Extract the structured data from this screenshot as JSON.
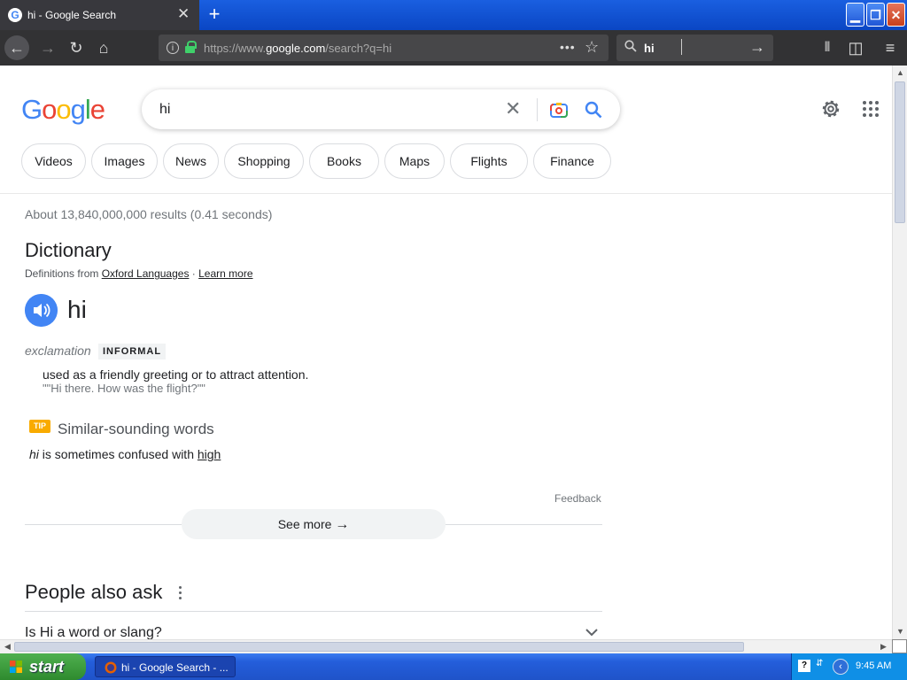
{
  "browser": {
    "tab_title": "hi - Google Search",
    "url_prefix": "https://www.",
    "url_domain": "google.com",
    "url_path": "/search?q=hi",
    "search_value": "hi"
  },
  "google": {
    "logo": [
      "G",
      "o",
      "o",
      "g",
      "l",
      "e"
    ],
    "logo_colors": [
      "#4285f4",
      "#ea4335",
      "#fbbc05",
      "#4285f4",
      "#34a853",
      "#ea4335"
    ],
    "query": "hi",
    "tabs": [
      "Videos",
      "Images",
      "News",
      "Shopping",
      "Books",
      "Maps",
      "Flights",
      "Finance"
    ],
    "stats": "About 13,840,000,000 results (0.41 seconds)"
  },
  "dictionary": {
    "title": "Dictionary",
    "source_prefix": "Definitions from ",
    "source_name": "Oxford Languages",
    "source_sep": " · ",
    "learn_more": "Learn more",
    "word": "hi",
    "part_of_speech": "exclamation",
    "register": "INFORMAL",
    "definition": "used as a friendly greeting or to attract attention.",
    "example": "\"\"Hi there. How was the flight?\"\"",
    "tip_badge": "TIP",
    "similar_title": "Similar-sounding words",
    "confused_word": "hi",
    "confused_text": " is sometimes confused with ",
    "confused_with": "high",
    "feedback": "Feedback",
    "see_more": "See more"
  },
  "people_also_ask": {
    "title": "People also ask",
    "questions": [
      "Is Hi a word or slang?"
    ]
  },
  "taskbar": {
    "start": "start",
    "task_label": "hi - Google Search - ...",
    "clock": "9:45 AM"
  }
}
